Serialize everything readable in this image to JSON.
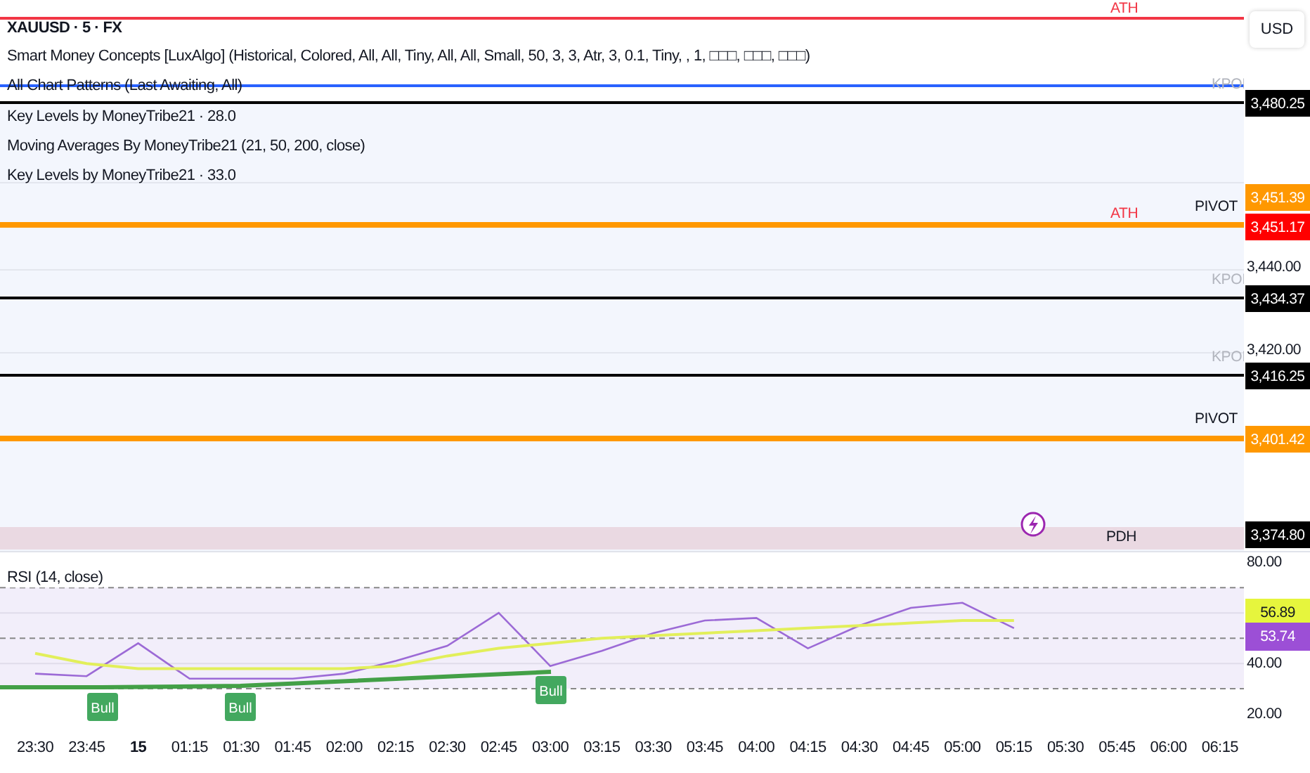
{
  "legend": {
    "title": "XAUUSD · 5 · FX",
    "indicators": [
      "Smart Money Concepts [LuxAlgo] (Historical, Colored, All, All, Tiny, All, All, Small, 50, 3, 3, Atr, 3, 0.1, Tiny, , 1, □□□, □□□, □□□)",
      "All Chart Patterns (Last Awaiting, All)",
      "Key Levels by MoneyTribe21 · 28.0",
      "Moving Averages By MoneyTribe21 (21, 50, 200, close)",
      "Key Levels by MoneyTribe21 · 33.0"
    ]
  },
  "levels": [
    {
      "color": "#f23645"
    },
    {
      "color": "#2962ff"
    },
    {
      "color": "#000000"
    },
    {
      "color": "#ff9800"
    },
    {
      "color": "#000000"
    },
    {
      "color": "#000000"
    },
    {
      "color": "#ff9800"
    }
  ],
  "level_labels": [
    {
      "text": "ATH",
      "color": "#f23645"
    },
    {
      "text": "KPOI",
      "color": "#b2b5be"
    },
    {
      "text": "ATH",
      "color": "#f23645"
    },
    {
      "text": "PIVOT",
      "color": "#131722"
    },
    {
      "text": "KPOI",
      "color": "#b2b5be"
    },
    {
      "text": "KPOI",
      "color": "#b2b5be"
    },
    {
      "text": "PIVOT",
      "color": "#131722"
    }
  ],
  "zone": {
    "label": "PDH"
  },
  "price_axis": {
    "currency": "USD",
    "labels": [
      {
        "kind": "tag",
        "text": "3,480.25",
        "color": "#000000"
      },
      {
        "kind": "tag",
        "text": "3,451.39",
        "color": "#ff9800"
      },
      {
        "kind": "tag",
        "text": "3,451.17",
        "color": "#ff0000"
      },
      {
        "kind": "tick",
        "text": "3,440.00"
      },
      {
        "kind": "tag",
        "text": "3,434.37",
        "color": "#000000"
      },
      {
        "kind": "tick",
        "text": "3,420.00"
      },
      {
        "kind": "tag",
        "text": "3,416.25",
        "color": "#000000"
      },
      {
        "kind": "tag",
        "text": "3,401.42",
        "color": "#ff9800"
      },
      {
        "kind": "tag",
        "text": "3,374.80",
        "color": "#000000"
      }
    ]
  },
  "rsi": {
    "title": "RSI (14, close)",
    "value_tags": [
      {
        "text": "56.89",
        "color": "#e6f53d"
      },
      {
        "text": "53.74",
        "color": "#9c4fd6"
      }
    ],
    "bold_labels": [
      false,
      false,
      true,
      false,
      false,
      false,
      false,
      false,
      false,
      false,
      false,
      false,
      false,
      false,
      false,
      false,
      false,
      false,
      false,
      false,
      false,
      false,
      false,
      false
    ],
    "chart_data": {
      "type": "line",
      "categories": [
        "23:30",
        "23:45",
        "15",
        "01:15",
        "01:30",
        "01:45",
        "02:00",
        "02:15",
        "02:30",
        "02:45",
        "03:00",
        "03:15",
        "03:30",
        "03:45",
        "04:00",
        "04:15",
        "04:30",
        "04:45",
        "05:00",
        "05:15",
        "05:30",
        "05:45",
        "06:00",
        "06:15"
      ],
      "yticks": [
        {
          "value": 80,
          "label": "80.00"
        },
        {
          "value": 40,
          "label": "40.00"
        },
        {
          "value": 20,
          "label": "20.00"
        }
      ],
      "ylim": [
        15,
        84
      ],
      "series": [
        {
          "color": "#9c6ad6",
          "values": [
            36,
            35,
            48,
            34,
            34,
            34,
            36,
            41,
            47,
            60,
            39,
            45,
            52,
            57,
            58,
            46,
            55,
            62,
            64,
            54,
            null,
            null,
            null,
            null
          ]
        },
        {
          "color": "#e2ef5a",
          "values": [
            44,
            40,
            38,
            38,
            38,
            38,
            38,
            39,
            43,
            46,
            48,
            50,
            51,
            52,
            53,
            54,
            55,
            56,
            57,
            57,
            null,
            null,
            null,
            null
          ]
        }
      ],
      "annotations": [
        {
          "text": "Bull"
        },
        {
          "text": "Bull"
        },
        {
          "text": "Bull"
        }
      ]
    }
  }
}
